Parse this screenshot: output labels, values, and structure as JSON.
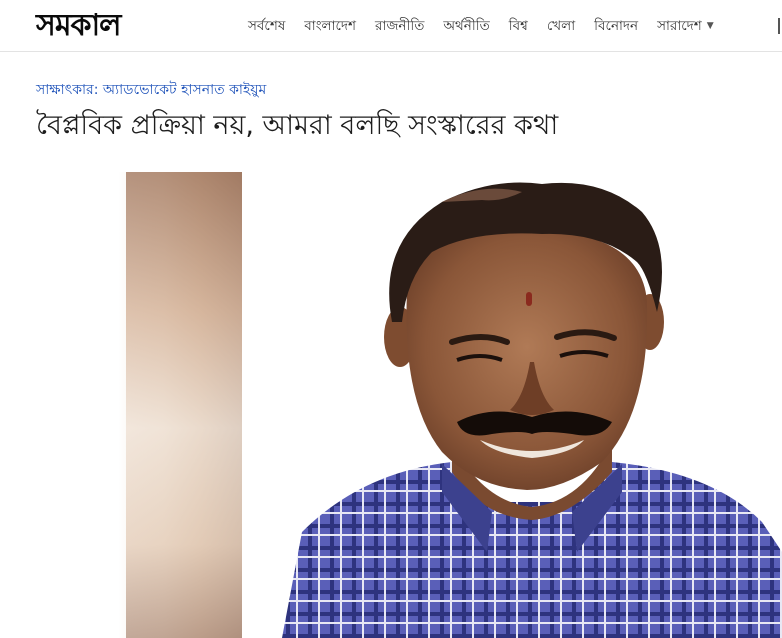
{
  "header": {
    "logo_text": "সমকাল",
    "nav": [
      {
        "label": "সর্বশেষ"
      },
      {
        "label": "বাংলাদেশ"
      },
      {
        "label": "রাজনীতি"
      },
      {
        "label": "অর্থনীতি"
      },
      {
        "label": "বিশ্ব"
      },
      {
        "label": "খেলা"
      },
      {
        "label": "বিনোদন"
      },
      {
        "label": "সারাদেশ",
        "has_dropdown": true
      }
    ],
    "dropdown_icon": "caret-down-icon"
  },
  "article": {
    "kicker": "সাক্ষাৎকার: অ্যাডভোকেট হাসনাত কাইয়ুম",
    "headline": "বৈপ্লবিক প্রক্রিয়া নয়, আমরা বলছি সংস্কারের কথা"
  },
  "colors": {
    "kicker": "#1a4fb8",
    "headline": "#1d1d1d",
    "shirt_check": "#3a3f9a",
    "background": "#ffffff"
  }
}
